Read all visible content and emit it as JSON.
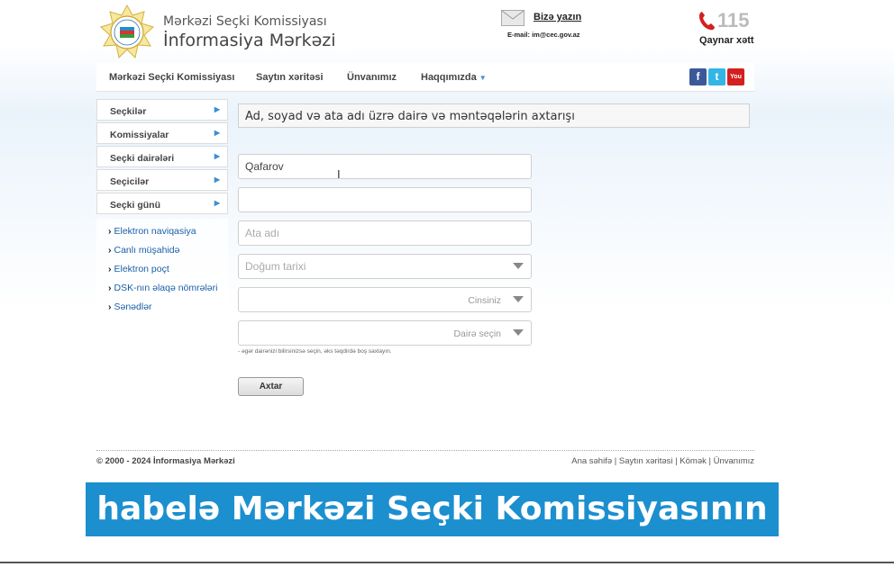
{
  "header": {
    "title_line1": "Mərkəzi Seçki Komissiyası",
    "title_line2": "İnformasiya Mərkəzi",
    "write_us": "Bizə yazın",
    "email": "E-mail: im@cec.gov.az",
    "hotline_number": "115",
    "hotline_label": "Qaynar xətt"
  },
  "topnav": {
    "items": [
      "Mərkəzi Seçki Komissiyası",
      "Saytın xəritəsi",
      "Ünvanımız",
      "Haqqımızda"
    ],
    "social": [
      "facebook-icon",
      "twitter-icon",
      "youtube-icon"
    ]
  },
  "sidebar": {
    "items": [
      "Seçkilər",
      "Komissiyalar",
      "Seçki dairələri",
      "Seçicilər",
      "Seçki günü"
    ],
    "links": [
      "Elektron naviqasiya",
      "Canlı müşahidə",
      "Elektron poçt",
      "DSK-nın əlaqə nömrələri",
      "Sənədlər"
    ]
  },
  "main": {
    "heading": "Ad, soyad və ata adı üzrə dairə və məntəqələrin axtarışı",
    "surname_value": "Qafarov",
    "name_value": "",
    "patronymic_placeholder": "Ata adı",
    "birthdate_placeholder": "Doğum tarixi",
    "gender_placeholder": "Cinsiniz",
    "district_placeholder": "Dairə seçin",
    "hint": "- əgər dairənizi bilirsinizsə seçin, əks təqdirdə boş saxlayın.",
    "search_button": "Axtar"
  },
  "footer": {
    "copyright": "© 2000 - 2024  İnformasiya Mərkəzi",
    "links": "Ana səhifə  | Saytın xəritəsi  | Kömək | Ünvanımız"
  },
  "caption": "habelə Mərkəzi Seçki Komissiyasının"
}
